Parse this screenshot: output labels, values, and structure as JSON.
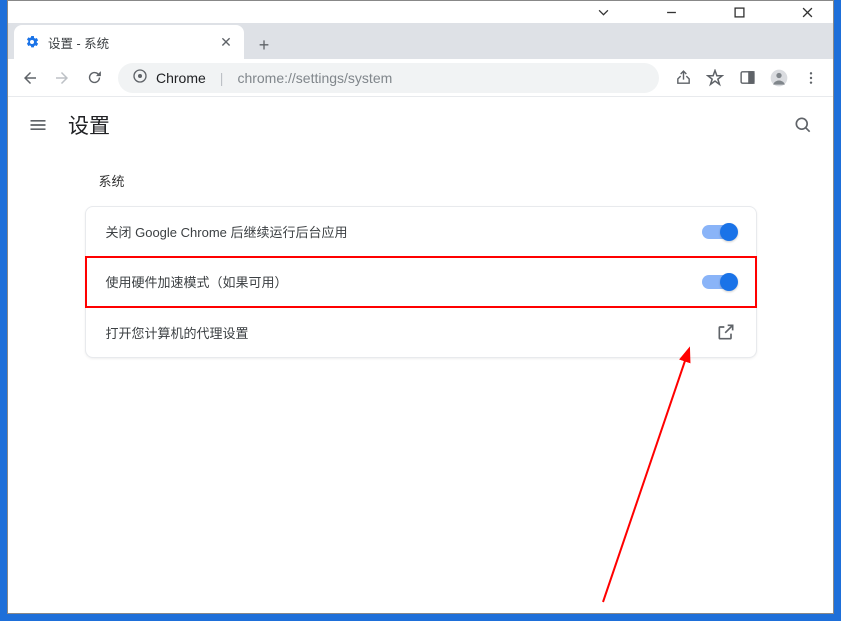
{
  "window": {
    "tab_title": "设置 - 系统"
  },
  "toolbar": {
    "url_origin": "Chrome",
    "url_path": "chrome://settings/system"
  },
  "appbar": {
    "title": "设置"
  },
  "section": {
    "title": "系统",
    "rows": [
      {
        "label": "关闭 Google Chrome 后继续运行后台应用",
        "type": "toggle",
        "on": true
      },
      {
        "label": "使用硬件加速模式（如果可用）",
        "type": "toggle",
        "on": true,
        "highlighted": true
      },
      {
        "label": "打开您计算机的代理设置",
        "type": "link"
      }
    ]
  }
}
